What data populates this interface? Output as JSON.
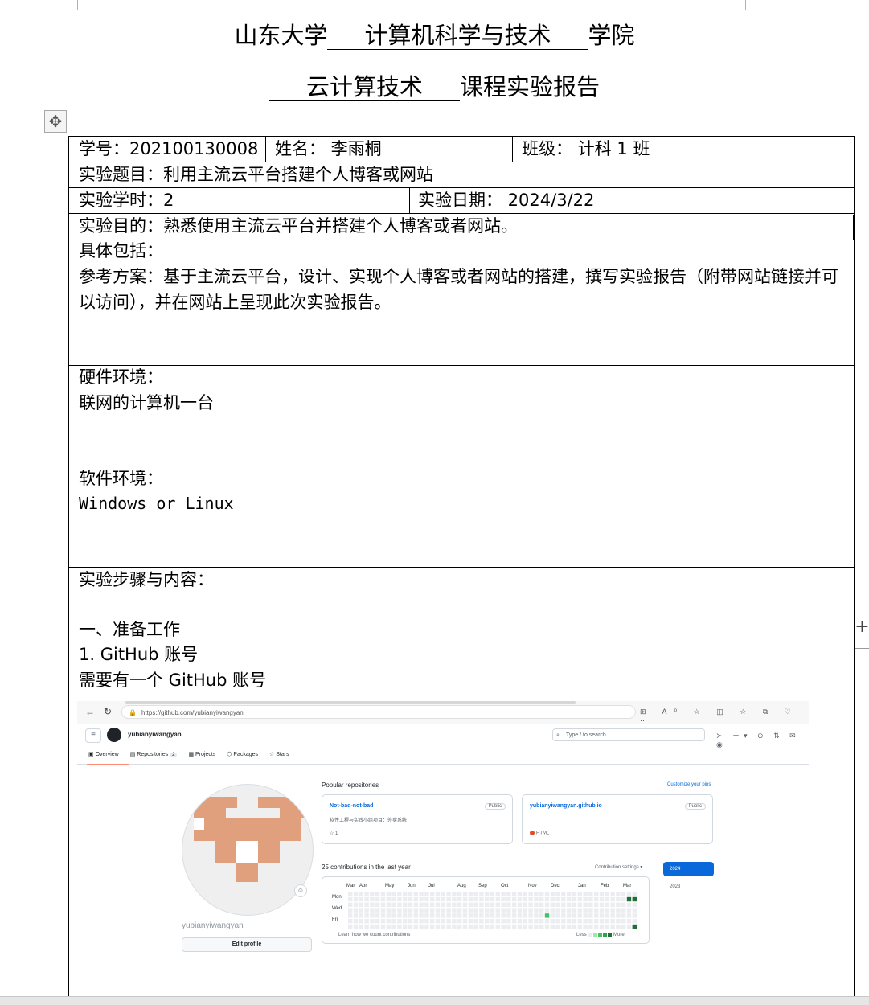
{
  "header": {
    "university": "山东大学",
    "college": "计算机科学与技术",
    "college_suffix": "学院",
    "course": "云计算技术",
    "report_suffix": "课程实验报告"
  },
  "info": {
    "student_id": "学号：202100130008",
    "name": "姓名：  李雨桐",
    "class": "班级：  计科 1 班",
    "topic": "实验题目：利用主流云平台搭建个人博客或网站",
    "hours": "实验学时：2",
    "date": "实验日期：      2024/3/22"
  },
  "purpose": {
    "line1": "实验目的：熟悉使用主流云平台并搭建个人博客或者网站。",
    "line2": "具体包括：",
    "line3": "参考方案：基于主流云平台，设计、实现个人博客或者网站的搭建，撰写实验报告（附带网站链接并可以访问），并在网站上呈现此次实验报告。"
  },
  "hardware": {
    "label": "硬件环境：",
    "value": "联网的计算机一台"
  },
  "software": {
    "label": "软件环境：",
    "value": "Windows or Linux"
  },
  "steps": {
    "label": "实验步骤与内容：",
    "section1": "一、准备工作",
    "item1": "1. GitHub 账号",
    "item1_desc": "需要有一个 GitHub 账号"
  },
  "screenshot": {
    "url": "https://github.com/yubianyiwangyan",
    "username": "yubianyiwangyan",
    "search_placeholder": "Type / to search",
    "tabs": {
      "overview": "Overview",
      "repositories": "Repositories",
      "repositories_count": "2",
      "projects": "Projects",
      "packages": "Packages",
      "stars": "Stars"
    },
    "profile_name": "yubianyiwangyan",
    "edit_profile": "Edit profile",
    "popular_title": "Popular repositories",
    "customize": "Customize your pins",
    "repos": [
      {
        "name": "Not-bad-not-bad",
        "visibility": "Public",
        "description": "软件工程与实践小组项目：外卖系统",
        "meta": "☆ 1"
      },
      {
        "name": "yubianyiwangyan.github.io",
        "visibility": "Public",
        "description": "",
        "meta": "HTML"
      }
    ],
    "contrib_title": "25 contributions in the last year",
    "contrib_settings": "Contribution settings ▾",
    "years": [
      "2024",
      "2023"
    ],
    "months": [
      "Mar",
      "Apr",
      "May",
      "Jun",
      "Jul",
      "Aug",
      "Sep",
      "Oct",
      "Nov",
      "Dec",
      "Jan",
      "Feb",
      "Mar"
    ],
    "days": [
      "Mon",
      "Wed",
      "Fri"
    ],
    "learn": "Learn how we count contributions",
    "less": "Less",
    "more": "More",
    "colors": {
      "empty": "#ebedf0",
      "l1": "#9be9a8",
      "l2": "#40c463",
      "l3": "#30a14e",
      "l4": "#216e39",
      "link": "#0969da",
      "avatar": "#e0a07e"
    }
  }
}
